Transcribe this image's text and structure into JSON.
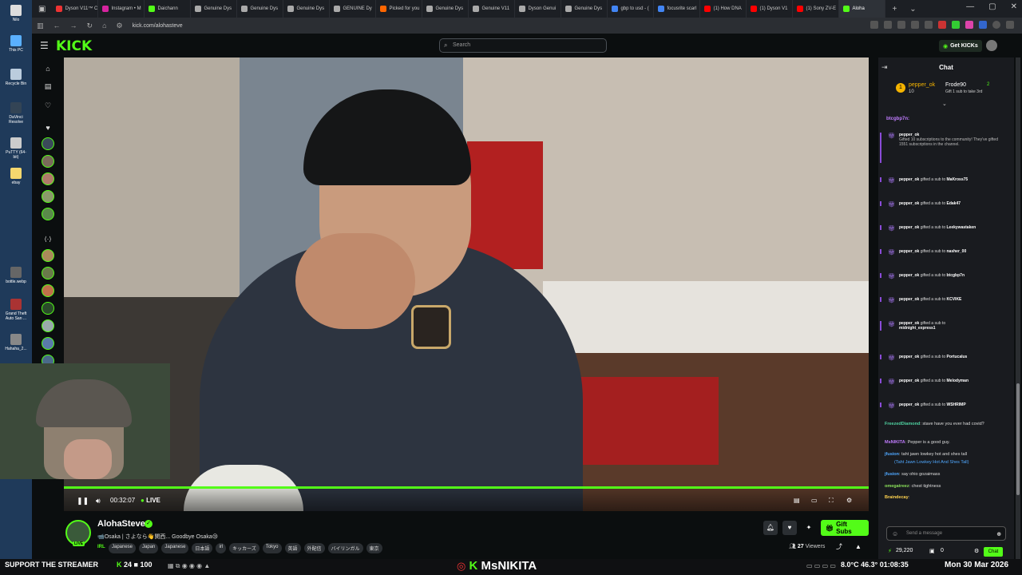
{
  "browser": {
    "tabs": [
      {
        "label": "Dyson V11™ C",
        "color": "#e33"
      },
      {
        "label": "Instagram • M",
        "color": "#d6249f"
      },
      {
        "label": "Daichann",
        "color": "#53fc18"
      },
      {
        "label": "Genuine Dys",
        "color": "#aaa"
      },
      {
        "label": "Genuine Dys",
        "color": "#aaa"
      },
      {
        "label": "Genuine Dys",
        "color": "#aaa"
      },
      {
        "label": "GENUINE Dy",
        "color": "#aaa"
      },
      {
        "label": "Picked for you",
        "color": "#f60"
      },
      {
        "label": "Genuine Dys",
        "color": "#aaa"
      },
      {
        "label": "Genuine V11",
        "color": "#aaa"
      },
      {
        "label": "Dyson Genui",
        "color": "#aaa"
      },
      {
        "label": "Genuine Dys",
        "color": "#aaa"
      },
      {
        "label": "gbp to usd - (",
        "color": "#4285f4"
      },
      {
        "label": "focusrite scarl",
        "color": "#4285f4"
      },
      {
        "label": "(1) How DNA",
        "color": "#f00"
      },
      {
        "label": "(1) Dyson V1",
        "color": "#f00"
      },
      {
        "label": "(1) Sony ZV-E",
        "color": "#f00"
      },
      {
        "label": "Aloha",
        "color": "#53fc18"
      }
    ],
    "url": "kick.com/alohasteve"
  },
  "desktop": {
    "icons": [
      "Nilo",
      "This PC",
      "Recycle Bin",
      "DaVinci Resolve",
      "PuTTY (64-bit)",
      "ebay",
      "bottle.webp",
      "Grand Theft Auto San ...",
      "Hahaha_2..."
    ]
  },
  "header": {
    "logo": "KICK",
    "search_placeholder": "Search",
    "get_kicks": "Get KICKs"
  },
  "player": {
    "time": "00:32:07",
    "live": "LIVE"
  },
  "stream": {
    "name": "AlohaSteve",
    "live_badge": "LIVE",
    "title": "📹Osaka | さよなら👋関西... Goodbye Osaka😢",
    "category": "IRL",
    "tags": [
      "Japanese",
      "Japan",
      "Japanese",
      "日本語",
      "irl",
      "キッカーズ",
      "Tokyo",
      "英語",
      "外配信",
      "バイリンガル",
      "東京"
    ],
    "gift_subs": "Gift Subs",
    "viewers_count": "27",
    "viewers_label": "Viewers"
  },
  "chat": {
    "title": "Chat",
    "pinned": {
      "user1": "pepper_ok",
      "user1_count": "10",
      "user2": "Frode90",
      "user2_count": "2",
      "user2_note": "Gift 1 sub to take 3rd"
    },
    "top_user": "btcgbp7n:",
    "big_gift": {
      "user": "pepper_ok",
      "text": "Gifted 10 subscriptions to the community! They've gifted 1551 subscriptions in the channel."
    },
    "gifts": [
      {
        "user": "pepper_ok",
        "text": "gifted a sub to",
        "target": "MaKross75"
      },
      {
        "user": "pepper_ok",
        "text": "gifted a sub to",
        "target": "Edak47"
      },
      {
        "user": "pepper_ok",
        "text": "gifted a sub to",
        "target": "Leekywastaken"
      },
      {
        "user": "pepper_ok",
        "text": "gifted a sub to",
        "target": "nasher_00"
      },
      {
        "user": "pepper_ok",
        "text": "gifted a sub to",
        "target": "btcgbp7n"
      },
      {
        "user": "pepper_ok",
        "text": "gifted a sub to",
        "target": "KCVIKE"
      },
      {
        "user": "pepper_ok",
        "text": "gifted a sub to",
        "target": "midnight_express1"
      },
      {
        "user": "pepper_ok",
        "text": "gifted a sub to",
        "target": "Portucalus"
      },
      {
        "user": "pepper_ok",
        "text": "gifted a sub to",
        "target": "Melodyman"
      },
      {
        "user": "pepper_ok",
        "text": "gifted a sub to",
        "target": "WSHRIMP"
      }
    ],
    "messages": [
      {
        "user": "FreezedDiamond",
        "color": "#4fd1a0",
        "text": "stave have you ever had covid?"
      },
      {
        "user": "MsNIKITA",
        "color": "#c07cff",
        "text": "Pepper is a good guy."
      },
      {
        "user": "jfusion",
        "color": "#4fa8ff",
        "text": "taht jawn lowkey hot and shes tall"
      },
      {
        "user": "",
        "color": "#4fa8ff",
        "text": "(Taht Jawn Lowkey Hot And Shes Tall)"
      },
      {
        "user": "jfusion",
        "color": "#4fa8ff",
        "text": "say ohio gozaimass"
      },
      {
        "user": "omegatreez",
        "color": "#8be05a",
        "text": "chest tightness"
      },
      {
        "user": "Braindecay",
        "color": "#ffd34f",
        "text": ""
      }
    ],
    "input_placeholder": "Send a message",
    "points": "29,220",
    "zero": "0",
    "send_label": "Chat"
  },
  "taskbar": {
    "support": "SUPPORT THE STREAMER",
    "count_a": "24",
    "count_b": "100",
    "streamer": "MsNIKITA",
    "temp": "8.0°C",
    "cpu": "46.3°",
    "clock": "01:08:35",
    "date": "Mon 30 Mar 2026"
  }
}
